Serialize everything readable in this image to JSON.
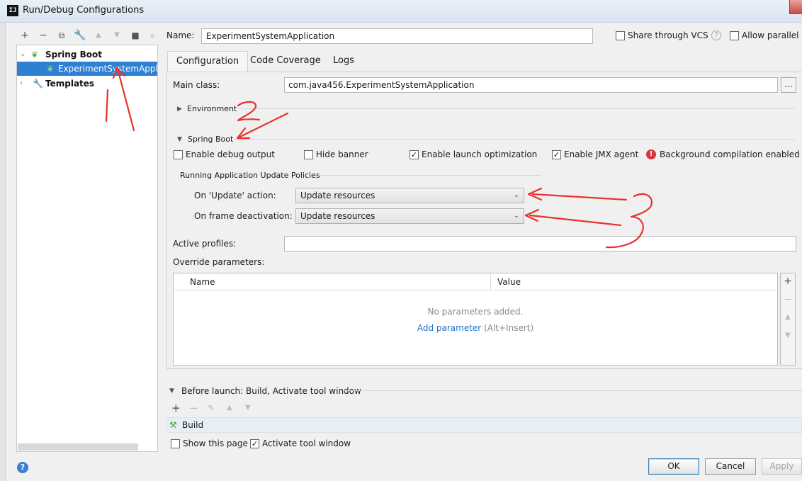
{
  "window": {
    "title": "Run/Debug Configurations",
    "app_icon": "IJ"
  },
  "tree_toolbar": {
    "icons": [
      "add-icon",
      "remove-icon",
      "copy-icon",
      "wrench-icon",
      "move-up-icon",
      "move-down-icon",
      "folder-icon",
      "more-icon"
    ]
  },
  "tree": {
    "group_label": "Spring Boot",
    "item_label": "ExperimentSystemApplication",
    "templates_label": "Templates"
  },
  "name_field": {
    "label": "Name:",
    "value": "ExperimentSystemApplication"
  },
  "share_vcs": {
    "label": "Share through VCS",
    "checked": false
  },
  "allow_parallel": {
    "label": "Allow parallel r",
    "checked": false
  },
  "tabs": [
    {
      "label": "Configuration",
      "active": true
    },
    {
      "label": "Code Coverage",
      "active": false
    },
    {
      "label": "Logs",
      "active": false
    }
  ],
  "main_class": {
    "label": "Main class:",
    "value": "com.java456.ExperimentSystemApplication",
    "browse": "..."
  },
  "environment_label": "Environment",
  "spring_boot_label": "Spring Boot",
  "options": {
    "debug_output": {
      "label": "Enable debug output",
      "checked": false
    },
    "hide_banner": {
      "label": "Hide banner",
      "checked": false
    },
    "launch_opt": {
      "label": "Enable launch optimization",
      "checked": true
    },
    "jmx_agent": {
      "label": "Enable JMX agent",
      "checked": true
    },
    "background_compilation": "Background compilation enabled"
  },
  "policies": {
    "title": "Running Application Update Policies",
    "update_action": {
      "label": "On 'Update' action:",
      "value": "Update resources"
    },
    "frame_deactivation": {
      "label": "On frame deactivation:",
      "value": "Update resources"
    }
  },
  "active_profiles": {
    "label": "Active profiles:",
    "value": ""
  },
  "override_params": {
    "label": "Override parameters:",
    "columns": [
      "Name",
      "Value"
    ],
    "empty_text": "No parameters added.",
    "add_link": "Add parameter",
    "add_hint": "(Alt+Insert)"
  },
  "before_launch": {
    "label": "Before launch: Build, Activate tool window",
    "task": "Build"
  },
  "show_page": {
    "label": "Show this page",
    "checked": false
  },
  "activate_tool": {
    "label": "Activate tool window",
    "checked": true
  },
  "buttons": {
    "ok": "OK",
    "cancel": "Cancel",
    "apply": "Apply"
  },
  "annotations": {
    "arrow_color": "#e8322b"
  }
}
